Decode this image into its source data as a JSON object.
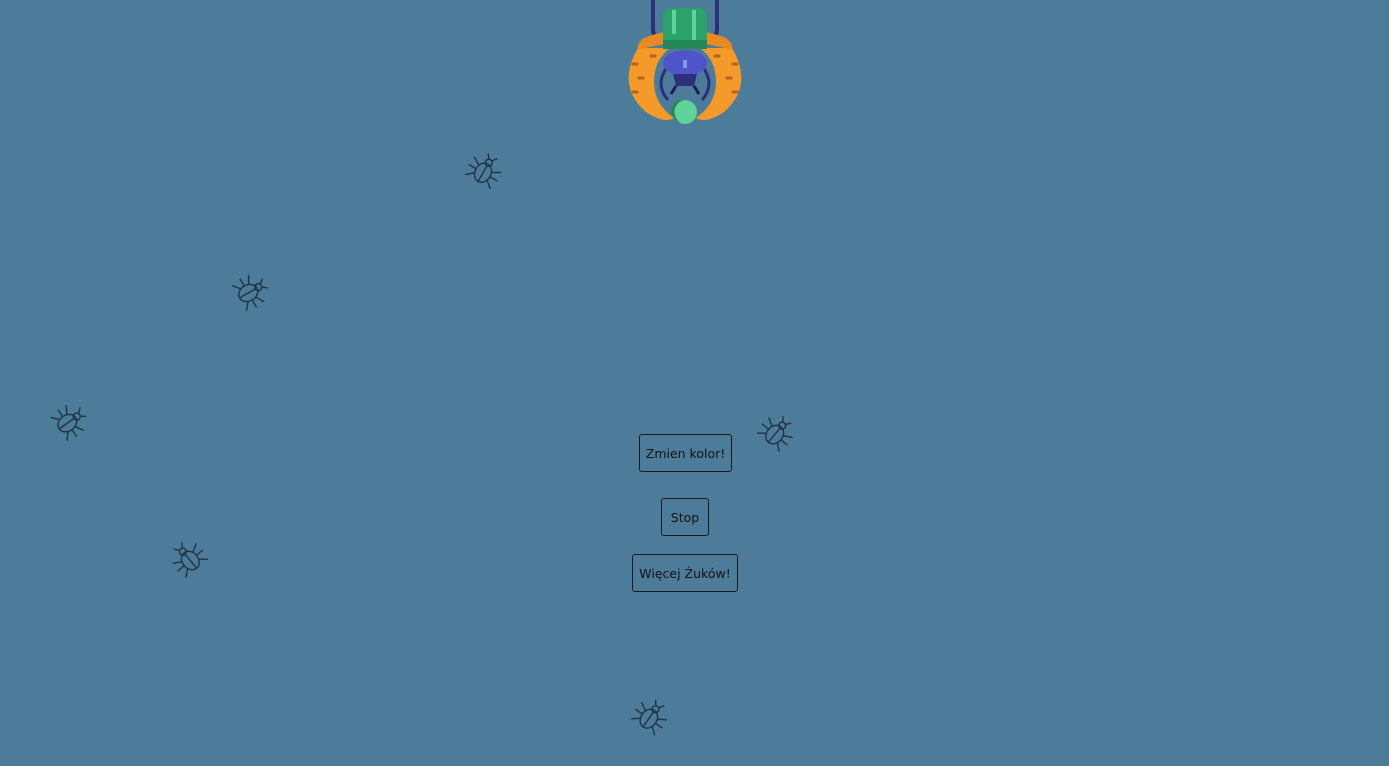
{
  "background_color": "#4d7c9b",
  "buttons": {
    "change_color": "Zmien kolor!",
    "stop": "Stop",
    "more_beetles": "Więcej Żuków!"
  },
  "beetles": {
    "count": 6,
    "color": "#1f3345"
  },
  "hero": {
    "icon": "beetle-character-icon"
  }
}
